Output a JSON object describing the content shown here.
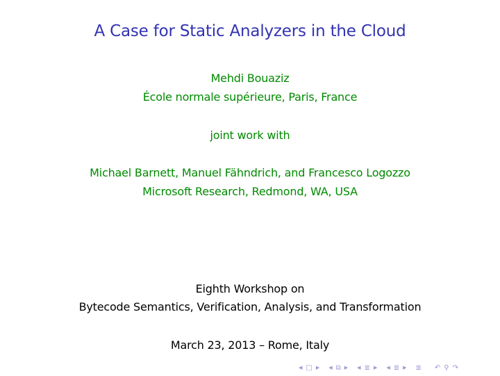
{
  "slide": {
    "title": "A Case for Static Analyzers in the Cloud",
    "author": "Mehdi Bouaziz",
    "affiliation": "École normale supérieure, Paris, France",
    "joint_label": "joint work with",
    "coauthors": "Michael Barnett, Manuel Fähndrich, and Francesco Logozzo",
    "coauthor_affiliation": "Microsoft Research, Redmond, WA, USA",
    "event_line1": "Eighth Workshop on",
    "event_line2": "Bytecode Semantics, Verification, Analysis, and Transformation",
    "date_place": "March 23, 2013 – Rome, Italy"
  },
  "colors": {
    "title": "#3333b3",
    "author_block": "#008a00",
    "event_block": "#000000",
    "nav": "#9a9ad6"
  },
  "nav": {
    "icons": [
      "frame-prev-icon",
      "frame-icon",
      "frame-next-icon",
      "subsection-prev-icon",
      "subsection-icon",
      "subsection-next-icon",
      "section-prev-icon",
      "section-icon",
      "section-next-icon",
      "subsection-prev2-icon",
      "subsection2-icon",
      "subsection-next2-icon",
      "document-icon",
      "back-icon",
      "search-icon",
      "forward-icon"
    ]
  }
}
